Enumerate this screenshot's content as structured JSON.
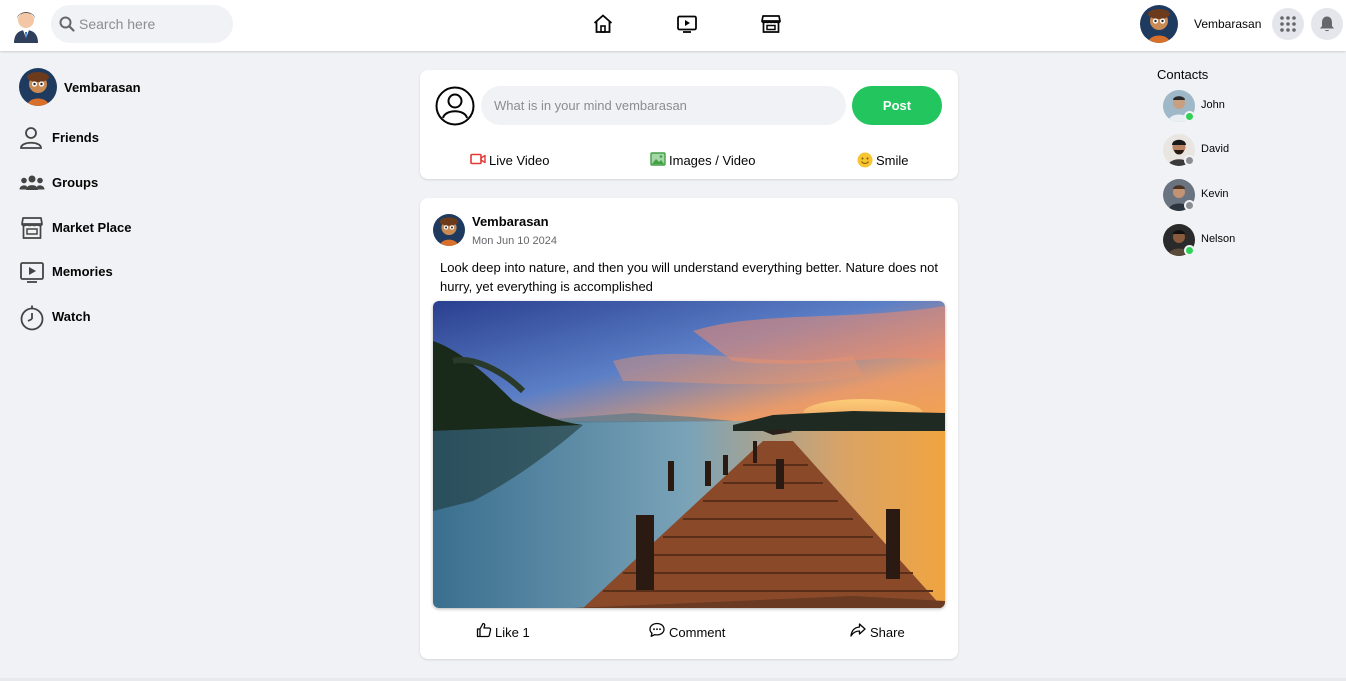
{
  "header": {
    "search_placeholder": "Search here",
    "username": "Vembarasan",
    "nav_icons": [
      "home-icon",
      "video-icon",
      "store-icon"
    ],
    "right_icons": [
      "grid-menu-icon",
      "bell-icon"
    ]
  },
  "sidebar": {
    "profile_name": "Vembarasan",
    "items": [
      {
        "label": "Friends",
        "icon": "friends-icon"
      },
      {
        "label": "Groups",
        "icon": "groups-icon"
      },
      {
        "label": "Market Place",
        "icon": "marketplace-icon"
      },
      {
        "label": "Memories",
        "icon": "memories-icon"
      },
      {
        "label": "Watch",
        "icon": "watch-icon"
      }
    ]
  },
  "create_post": {
    "placeholder": "What is in your mind vembarasan",
    "post_label": "Post",
    "actions": [
      {
        "label": "Live Video",
        "icon": "video-camera-icon"
      },
      {
        "label": "Images / Video",
        "icon": "image-icon"
      },
      {
        "label": "Smile",
        "icon": "smile-icon"
      }
    ]
  },
  "feed_post": {
    "author": "Vembarasan",
    "date": "Mon Jun 10 2024",
    "text": "Look deep into nature, and then you will understand everything better. Nature does not hurry, yet everything is accomplished",
    "like_label": "Like 1",
    "comment_label": "Comment",
    "share_label": "Share"
  },
  "contacts": {
    "title": "Contacts",
    "items": [
      {
        "name": "John",
        "online": true
      },
      {
        "name": "David",
        "online": false
      },
      {
        "name": "Kevin",
        "online": false
      },
      {
        "name": "Nelson",
        "online": true
      }
    ]
  },
  "colors": {
    "accent_green": "#22c55e",
    "online": "#31d158",
    "offline": "#8a8d91",
    "live_red": "#e53935",
    "image_green": "#43a047",
    "smile_yellow": "#f7c531"
  }
}
